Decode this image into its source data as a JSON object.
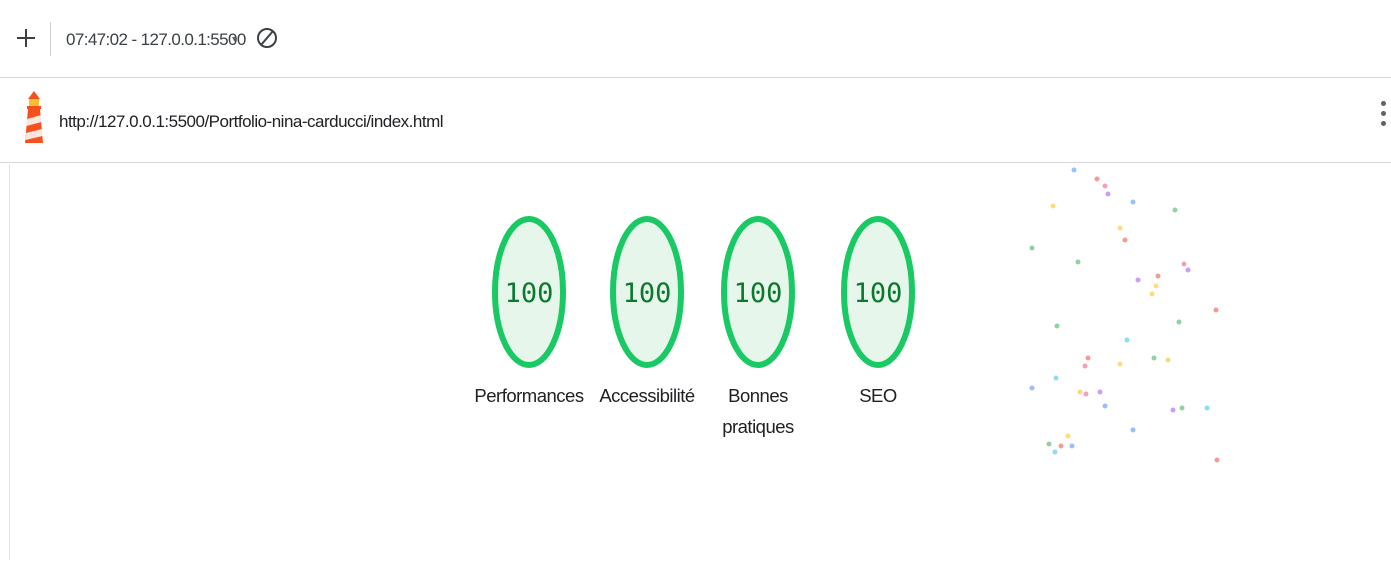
{
  "toolbar": {
    "report_selector": "07:47:02 - 127.0.0.1:5500",
    "caret": "▾"
  },
  "urlbar": {
    "url": "http://127.0.0.1:5500/Portfolio-nina-carducci/index.html"
  },
  "scores": [
    {
      "category": "performance",
      "label": "Performances",
      "score": "100"
    },
    {
      "category": "accessibility",
      "label": "Accessibilité",
      "score": "100"
    },
    {
      "category": "best-practices",
      "label": "Bonnes pratiques",
      "score": "100"
    },
    {
      "category": "seo",
      "label": "SEO",
      "score": "100"
    }
  ],
  "colors": {
    "pass_ring": "#18c964",
    "pass_fill": "#e6f6ea",
    "pass_text": "#0b7a2f"
  },
  "icons": {
    "add": "plus-icon",
    "clear": "clear-icon",
    "logo": "lighthouse-logo-icon",
    "menu": "kebab-menu-icon"
  }
}
